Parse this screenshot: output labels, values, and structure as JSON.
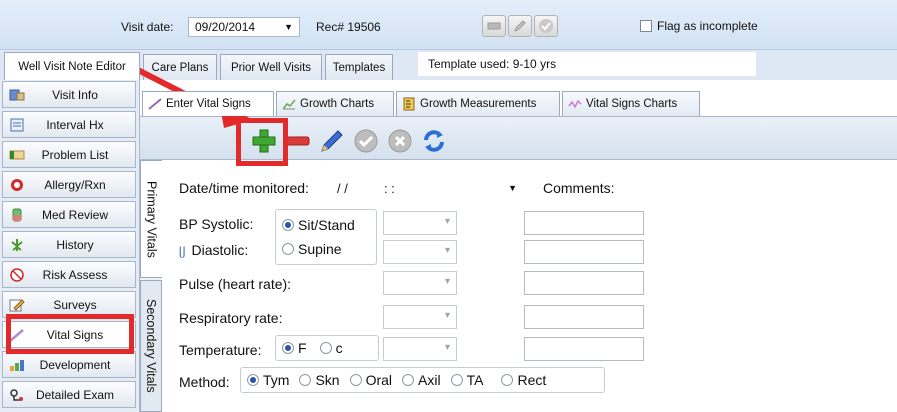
{
  "header": {
    "visit_date_label": "Visit date:",
    "visit_date_value": "09/20/2014",
    "rec_label": "Rec# 19506",
    "flag_label": "Flag as incomplete"
  },
  "top_tabs": [
    {
      "label": "Well Visit Note Editor",
      "active": true
    },
    {
      "label": "Care Plans"
    },
    {
      "label": "Prior Well Visits"
    },
    {
      "label": "Templates"
    }
  ],
  "template_used": "Template used:  9-10 yrs",
  "sidebar": {
    "items": [
      {
        "label": "Visit Info",
        "icon": "visit-info-icon"
      },
      {
        "label": "Interval Hx",
        "icon": "interval-hx-icon"
      },
      {
        "label": "Problem List",
        "icon": "problem-list-icon"
      },
      {
        "label": "Allergy/Rxn",
        "icon": "allergy-icon"
      },
      {
        "label": "Med Review",
        "icon": "med-review-icon"
      },
      {
        "label": "History",
        "icon": "history-icon"
      },
      {
        "label": "Risk Assess",
        "icon": "risk-assess-icon"
      },
      {
        "label": "Surveys",
        "icon": "surveys-icon"
      },
      {
        "label": "Vital Signs",
        "icon": "vital-signs-icon",
        "active": true
      },
      {
        "label": "Development",
        "icon": "development-icon"
      },
      {
        "label": "Detailed Exam",
        "icon": "detailed-exam-icon"
      }
    ]
  },
  "sub_tabs": [
    {
      "label": "Enter Vital Signs",
      "icon": "pencil-icon",
      "active": true
    },
    {
      "label": "Growth Charts",
      "icon": "growth-chart-icon"
    },
    {
      "label": "Growth Measurements",
      "icon": "ruler-icon"
    },
    {
      "label": "Vital Signs Charts",
      "icon": "vitals-chart-icon"
    }
  ],
  "toolbar": [
    "add-icon",
    "remove-icon",
    "edit-icon",
    "accept-icon",
    "cancel-icon",
    "refresh-icon"
  ],
  "vertical_tabs": {
    "primary": "Primary Vitals",
    "secondary": "Secondary Vitals"
  },
  "form": {
    "datetime_label": "Date/time monitored:",
    "datetime_value": "/ /          : :",
    "comments_label": "Comments:",
    "bp_systolic_label": "BP Systolic:",
    "bp_diastolic_label": "Diastolic:",
    "position_sit": "Sit/Stand",
    "position_supine": "Supine",
    "pulse_label": "Pulse (heart rate):",
    "resp_label": "Respiratory rate:",
    "temp_label": "Temperature:",
    "temp_f": "F",
    "temp_c": "c",
    "method_label": "Method:",
    "methods": [
      "Tym",
      "Skn",
      "Oral",
      "Axil",
      "TA",
      "Rect"
    ]
  },
  "colors": {
    "highlight": "#e32a2a",
    "accent": "#2a55a8"
  }
}
